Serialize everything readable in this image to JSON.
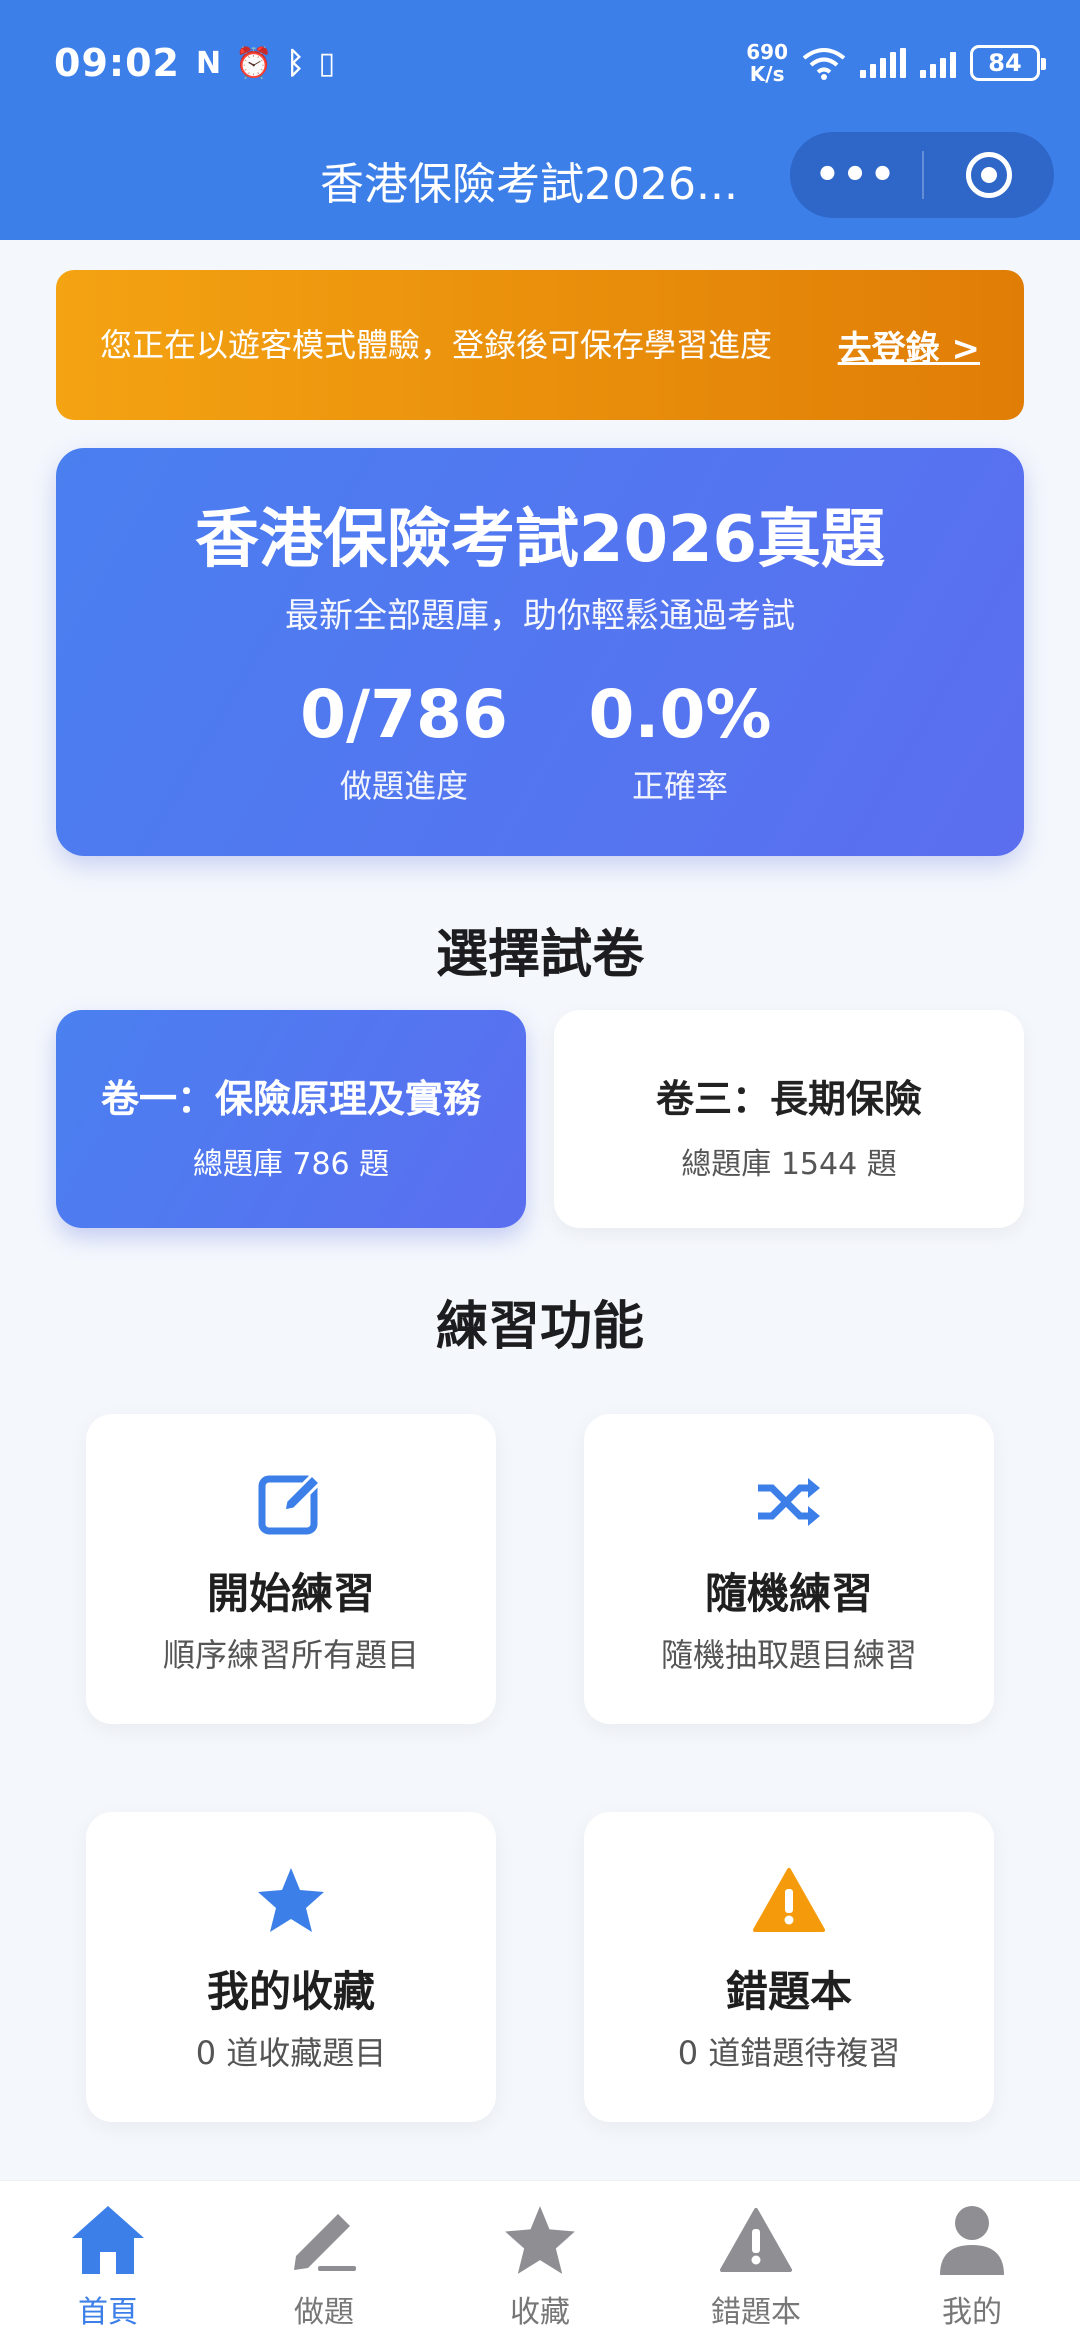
{
  "status_bar": {
    "time": "09:02",
    "net_speed_value": "690",
    "net_speed_unit": "K/s",
    "battery": "84"
  },
  "nav": {
    "title": "香港保險考試2026...",
    "more_label": "•••"
  },
  "guest_banner": {
    "message": "您正在以遊客模式體驗，登錄後可保存學習進度",
    "login_link": "去登錄 >"
  },
  "hero": {
    "title": "香港保險考試2026真題",
    "subtitle": "最新全部題庫，助你輕鬆通過考試",
    "progress_value": "0/786",
    "progress_label": "做題進度",
    "accuracy_value": "0.0%",
    "accuracy_label": "正確率"
  },
  "papers_section": {
    "title": "選擇試卷",
    "papers": [
      {
        "title": "卷一：保險原理及實務",
        "count": "總題庫 786 題"
      },
      {
        "title": "卷三：長期保險",
        "count": "總題庫 1544 題"
      }
    ]
  },
  "practice_section": {
    "title": "練習功能",
    "cards": [
      {
        "icon": "edit-icon",
        "title": "開始練習",
        "subtitle": "順序練習所有題目"
      },
      {
        "icon": "shuffle-icon",
        "title": "隨機練習",
        "subtitle": "隨機抽取題目練習"
      },
      {
        "icon": "star-icon",
        "title": "我的收藏",
        "subtitle": "0 道收藏題目"
      },
      {
        "icon": "warning-icon",
        "title": "錯題本",
        "subtitle": "0 道錯題待複習"
      }
    ]
  },
  "tabbar": {
    "items": [
      {
        "label": "首頁",
        "icon": "home-icon"
      },
      {
        "label": "做題",
        "icon": "pencil-icon"
      },
      {
        "label": "收藏",
        "icon": "star-icon"
      },
      {
        "label": "錯題本",
        "icon": "warning-icon"
      },
      {
        "label": "我的",
        "icon": "user-icon"
      }
    ]
  },
  "colors": {
    "primary": "#3d7fe8",
    "banner": "#f09812",
    "star": "#3d7fe8",
    "warning": "#f59a0a"
  }
}
